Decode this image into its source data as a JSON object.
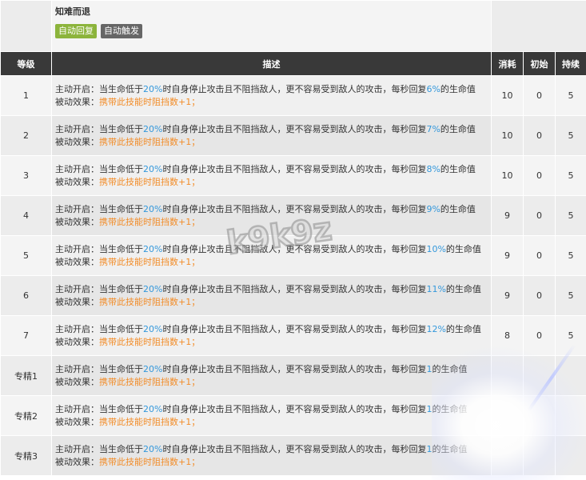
{
  "skill": {
    "name": "知难而退",
    "tags": [
      "自动回复",
      "自动触发"
    ]
  },
  "columns": {
    "level": "等级",
    "description": "描述",
    "cost": "消耗",
    "initial": "初始",
    "duration": "持续"
  },
  "desc_parts": {
    "active_prefix": "主动开启：当生命低于",
    "threshold": "20%",
    "active_middle": "时自身停止攻击且不阻挡敌人，更不容易受到敌人的攻击，每秒回复",
    "active_suffix": "的生命值",
    "passive_prefix": "被动效果：",
    "passive_effect": "携带此技能时阻挡数+1；"
  },
  "rows": [
    {
      "level": "1",
      "heal": "6%",
      "cost": "10",
      "initial": "0",
      "duration": "5"
    },
    {
      "level": "2",
      "heal": "7%",
      "cost": "10",
      "initial": "0",
      "duration": "5"
    },
    {
      "level": "3",
      "heal": "8%",
      "cost": "10",
      "initial": "0",
      "duration": "5"
    },
    {
      "level": "4",
      "heal": "9%",
      "cost": "9",
      "initial": "0",
      "duration": "5"
    },
    {
      "level": "5",
      "heal": "10%",
      "cost": "9",
      "initial": "0",
      "duration": "5"
    },
    {
      "level": "6",
      "heal": "11%",
      "cost": "9",
      "initial": "0",
      "duration": "5"
    },
    {
      "level": "7",
      "heal": "12%",
      "cost": "8",
      "initial": "0",
      "duration": "5"
    },
    {
      "level": "专精1",
      "heal": "1",
      "cost": "",
      "initial": "",
      "duration": ""
    },
    {
      "level": "专精2",
      "heal": "1",
      "cost": "",
      "initial": "",
      "duration": ""
    },
    {
      "level": "专精3",
      "heal": "1",
      "cost": "",
      "initial": "",
      "duration": ""
    }
  ],
  "watermark": "k9k9z",
  "colors": {
    "header_bg": "#393939",
    "highlight_blue": "#3498db",
    "highlight_orange": "#f28c28",
    "tag_green": "#8cb43c",
    "tag_gray": "#666666"
  }
}
